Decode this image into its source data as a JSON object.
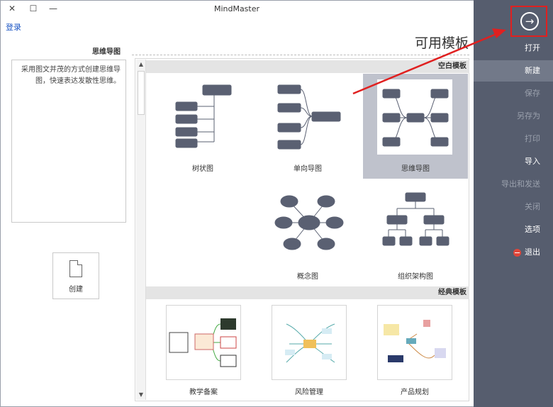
{
  "window": {
    "title": "MindMaster",
    "close_glyph": "✕",
    "maximize_glyph": "☐",
    "minimize_glyph": "—",
    "login_label": "登录"
  },
  "sidebar": {
    "back_icon": "arrow-right-circle-icon",
    "back_glyph": "→",
    "items": [
      {
        "label": "打开",
        "state": "normal"
      },
      {
        "label": "新建",
        "state": "active"
      },
      {
        "label": "保存",
        "state": "disabled"
      },
      {
        "label": "另存为",
        "state": "disabled"
      },
      {
        "label": "打印",
        "state": "disabled"
      },
      {
        "label": "导入",
        "state": "normal"
      },
      {
        "label": "导出和发送",
        "state": "disabled"
      },
      {
        "label": "关闭",
        "state": "disabled"
      },
      {
        "label": "选项",
        "state": "normal"
      },
      {
        "label": "退出",
        "state": "normal",
        "icon": "exit-icon"
      }
    ]
  },
  "page_title": "可用模板",
  "left_panel": {
    "heading": "思维导图",
    "description": "采用图文并茂的方式创建思维导图，快速表达发散性思维。",
    "create_label": "创建"
  },
  "sections": {
    "blank": "空白模板",
    "classic": "经典模板"
  },
  "blank_templates": [
    {
      "label": "思维导图",
      "selected": true
    },
    {
      "label": "单向导图",
      "selected": false
    },
    {
      "label": "树状图",
      "selected": false
    },
    {
      "label": "组织架构图",
      "selected": false
    },
    {
      "label": "概念图",
      "selected": false
    }
  ],
  "classic_templates": [
    {
      "label": "产品规划"
    },
    {
      "label": "风险管理"
    },
    {
      "label": "教学备案"
    }
  ],
  "colors": {
    "sidebar_bg": "#565d6e",
    "sidebar_active": "#727989",
    "highlight_red": "#e02020",
    "node_fill": "#5a6072"
  }
}
